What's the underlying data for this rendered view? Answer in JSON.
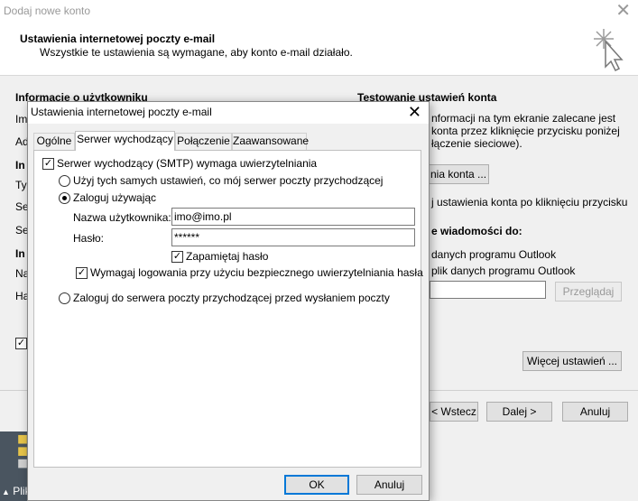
{
  "background_window": {
    "title": "Dodaj nowe konto",
    "header": {
      "title": "Ustawienia internetowej poczty e-mail",
      "subtitle": "Wszystkie te ustawienia są wymagane, aby konto e-mail działało."
    },
    "left_section_heading": "Informacje o użytkowniku",
    "left_fragments": [
      "Im",
      "Ad",
      "In",
      "Ty",
      "Se",
      "Se",
      "In",
      "Na",
      "Ha"
    ],
    "test_heading": "Testowanie ustawień konta",
    "test_text_lines": [
      "nformacji na tym ekranie zalecane jest",
      "konta przez kliknięcie przycisku poniżej",
      "łączenie sieciowe)."
    ],
    "test_button_label": "nia konta ...",
    "test_auto_text": "j ustawienia konta po kliknięciu przycisku",
    "deliver_heading": "e wiadomości do:",
    "deliver_option1": "danych programu Outlook",
    "deliver_option2": "plik danych programu Outlook",
    "browse_label": "Przeglądaj",
    "more_settings_label": "Więcej ustawień ...",
    "back_label": "< Wstecz",
    "next_label": "Dalej >",
    "cancel_label": "Anuluj",
    "taskbar_text": "Plik"
  },
  "dialog": {
    "title": "Ustawienia internetowej poczty e-mail",
    "tabs": [
      {
        "label": "Ogólne"
      },
      {
        "label": "Serwer wychodzący"
      },
      {
        "label": "Połączenie"
      },
      {
        "label": "Zaawansowane"
      }
    ],
    "outgoing": {
      "requires_auth_label": "Serwer wychodzący (SMTP) wymaga uwierzytelniania",
      "requires_auth_checked": true,
      "same_settings_label": "Użyj tych samych ustawień, co mój serwer poczty przychodzącej",
      "login_using_label": "Zaloguj używając",
      "username_label": "Nazwa użytkownika:",
      "username_value": "imo@imo.pl",
      "password_label": "Hasło:",
      "password_value": "******",
      "remember_password_label": "Zapamiętaj hasło",
      "remember_password_checked": true,
      "spa_label": "Wymagaj logowania przy użyciu bezpiecznego uwierzytelniania hasła",
      "spa_checked": true,
      "login_incoming_first_label": "Zaloguj do serwera poczty przychodzącej przed wysłaniem poczty",
      "selected_option": "login_using"
    },
    "ok_label": "OK",
    "cancel_label": "Anuluj"
  }
}
